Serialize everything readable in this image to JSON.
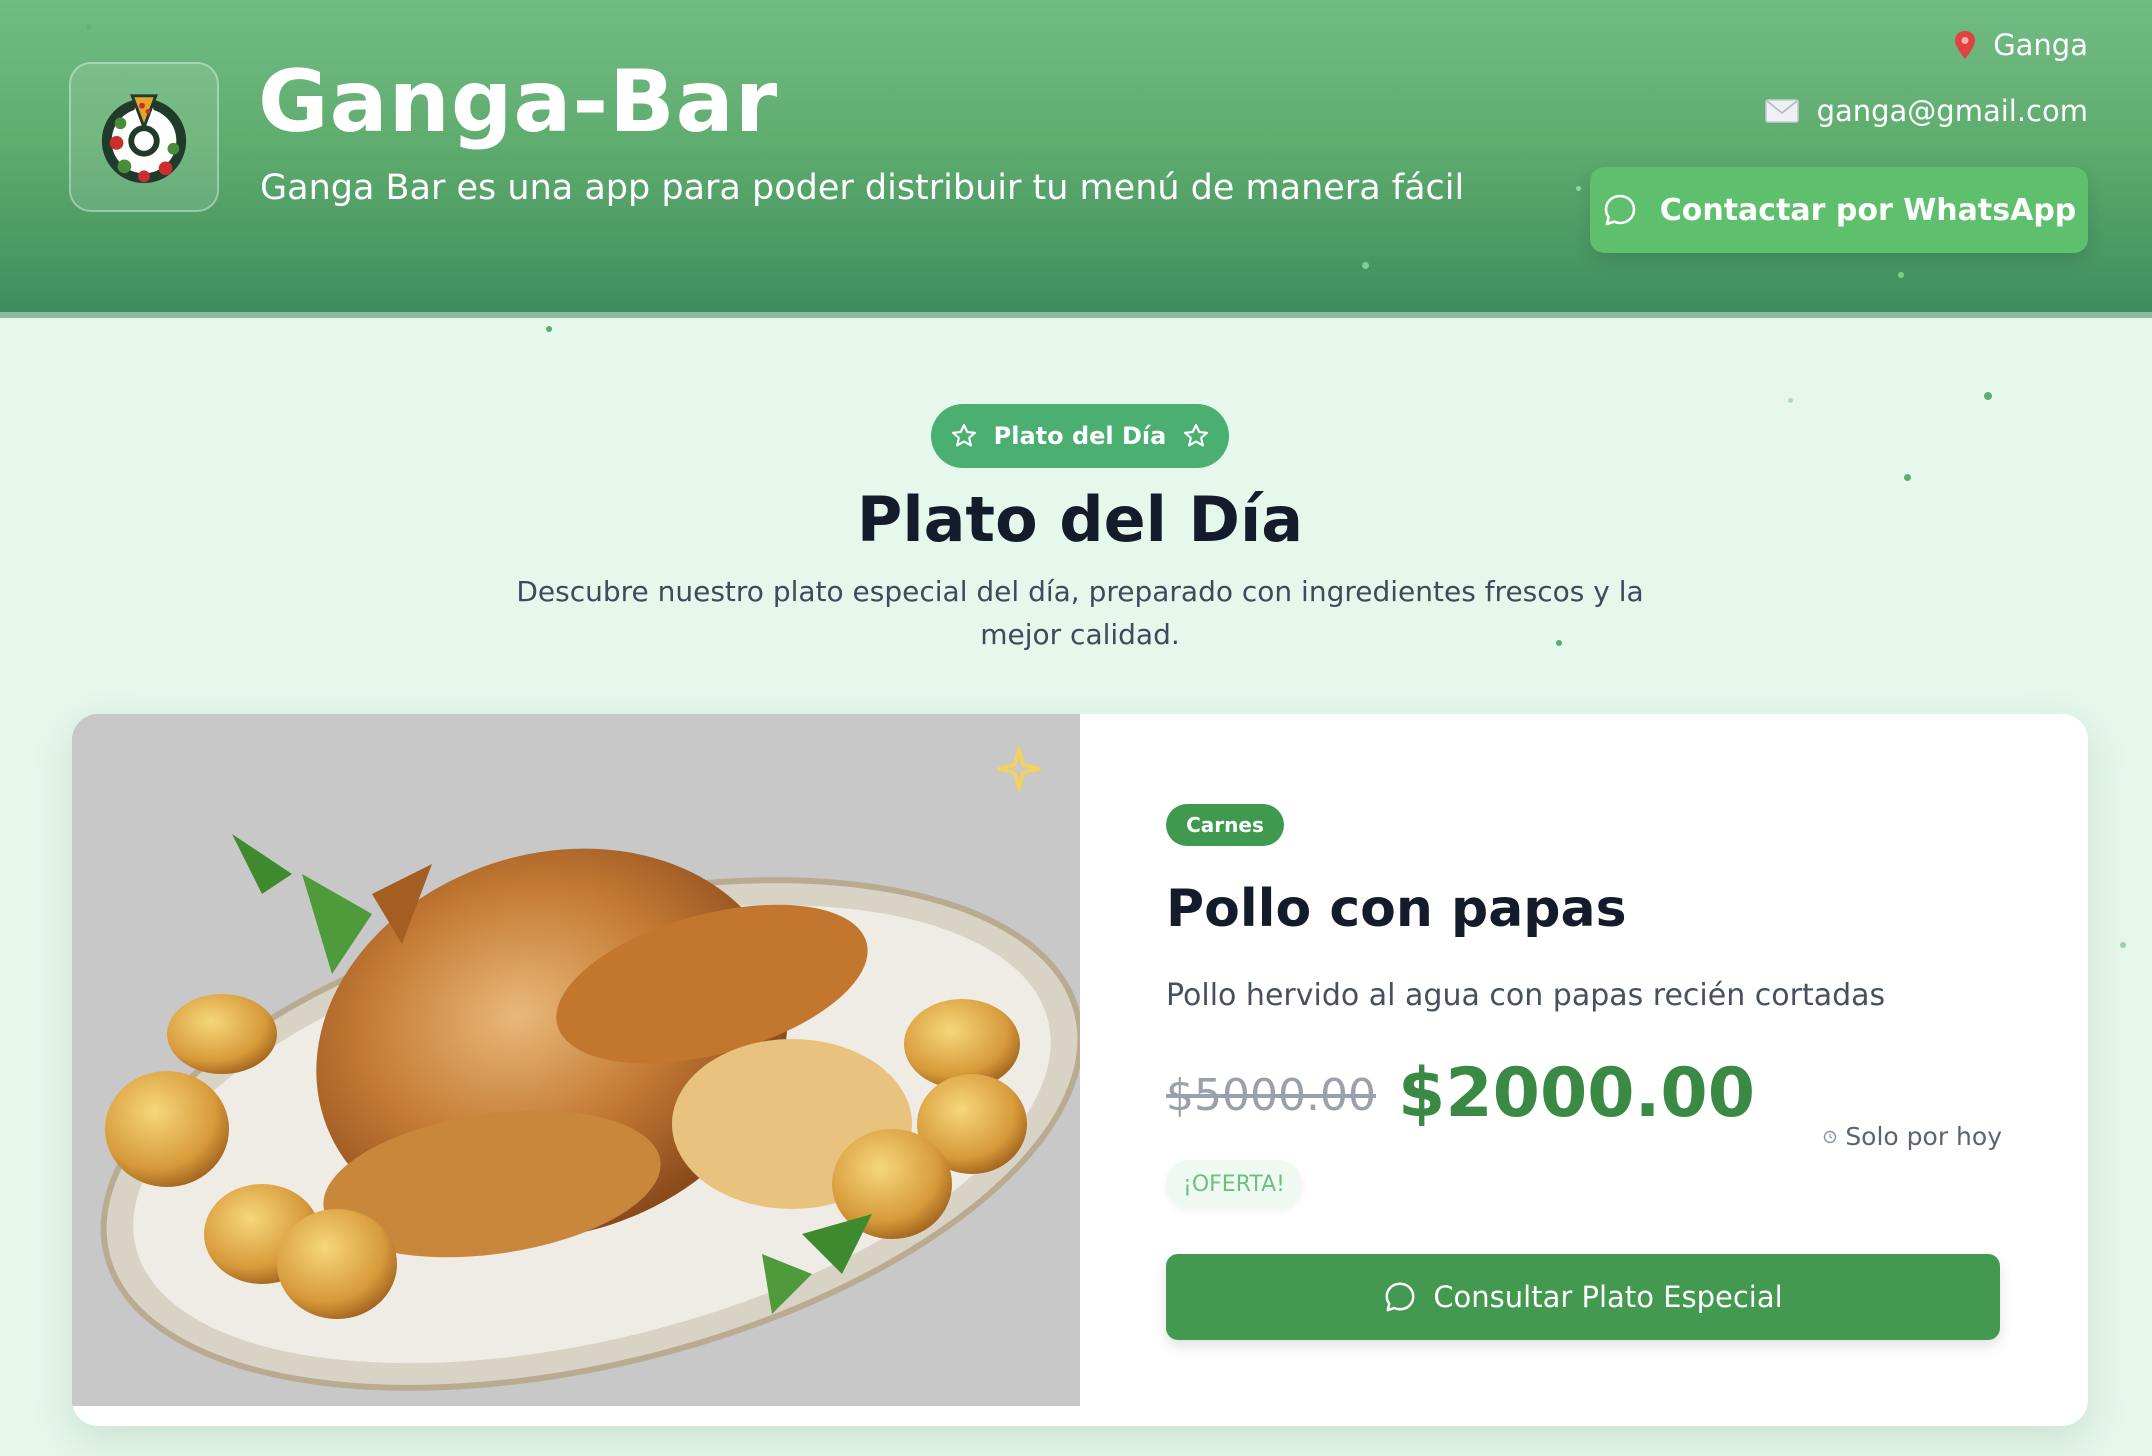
{
  "header": {
    "app_name": "Ganga-Bar",
    "tagline": "Ganga Bar es una app para poder distribuir tu menú de manera fácil",
    "location_icon": "map-pin-icon",
    "location": "Ganga",
    "email_icon": "envelope-icon",
    "email": "ganga@gmail.com",
    "whatsapp_button_label": "Contactar por WhatsApp"
  },
  "special": {
    "badge_label": "Plato del Día",
    "title": "Plato del Día",
    "description": "Descubre nuestro plato especial del día, preparado con ingredientes frescos y la mejor calidad."
  },
  "dish": {
    "category": "Carnes",
    "name": "Pollo con papas",
    "description": "Pollo hervido al agua con papas recién cortadas",
    "old_price": "$5000.00",
    "price": "$2000.00",
    "availability": "Solo por hoy",
    "offer_label": "¡OFERTA!",
    "consult_button_label": "Consultar Plato Especial"
  },
  "colors": {
    "header_green": "#5fac6f",
    "accent_green": "#43994f",
    "price_green": "#3a8a45",
    "background": "#e6f7ec"
  }
}
